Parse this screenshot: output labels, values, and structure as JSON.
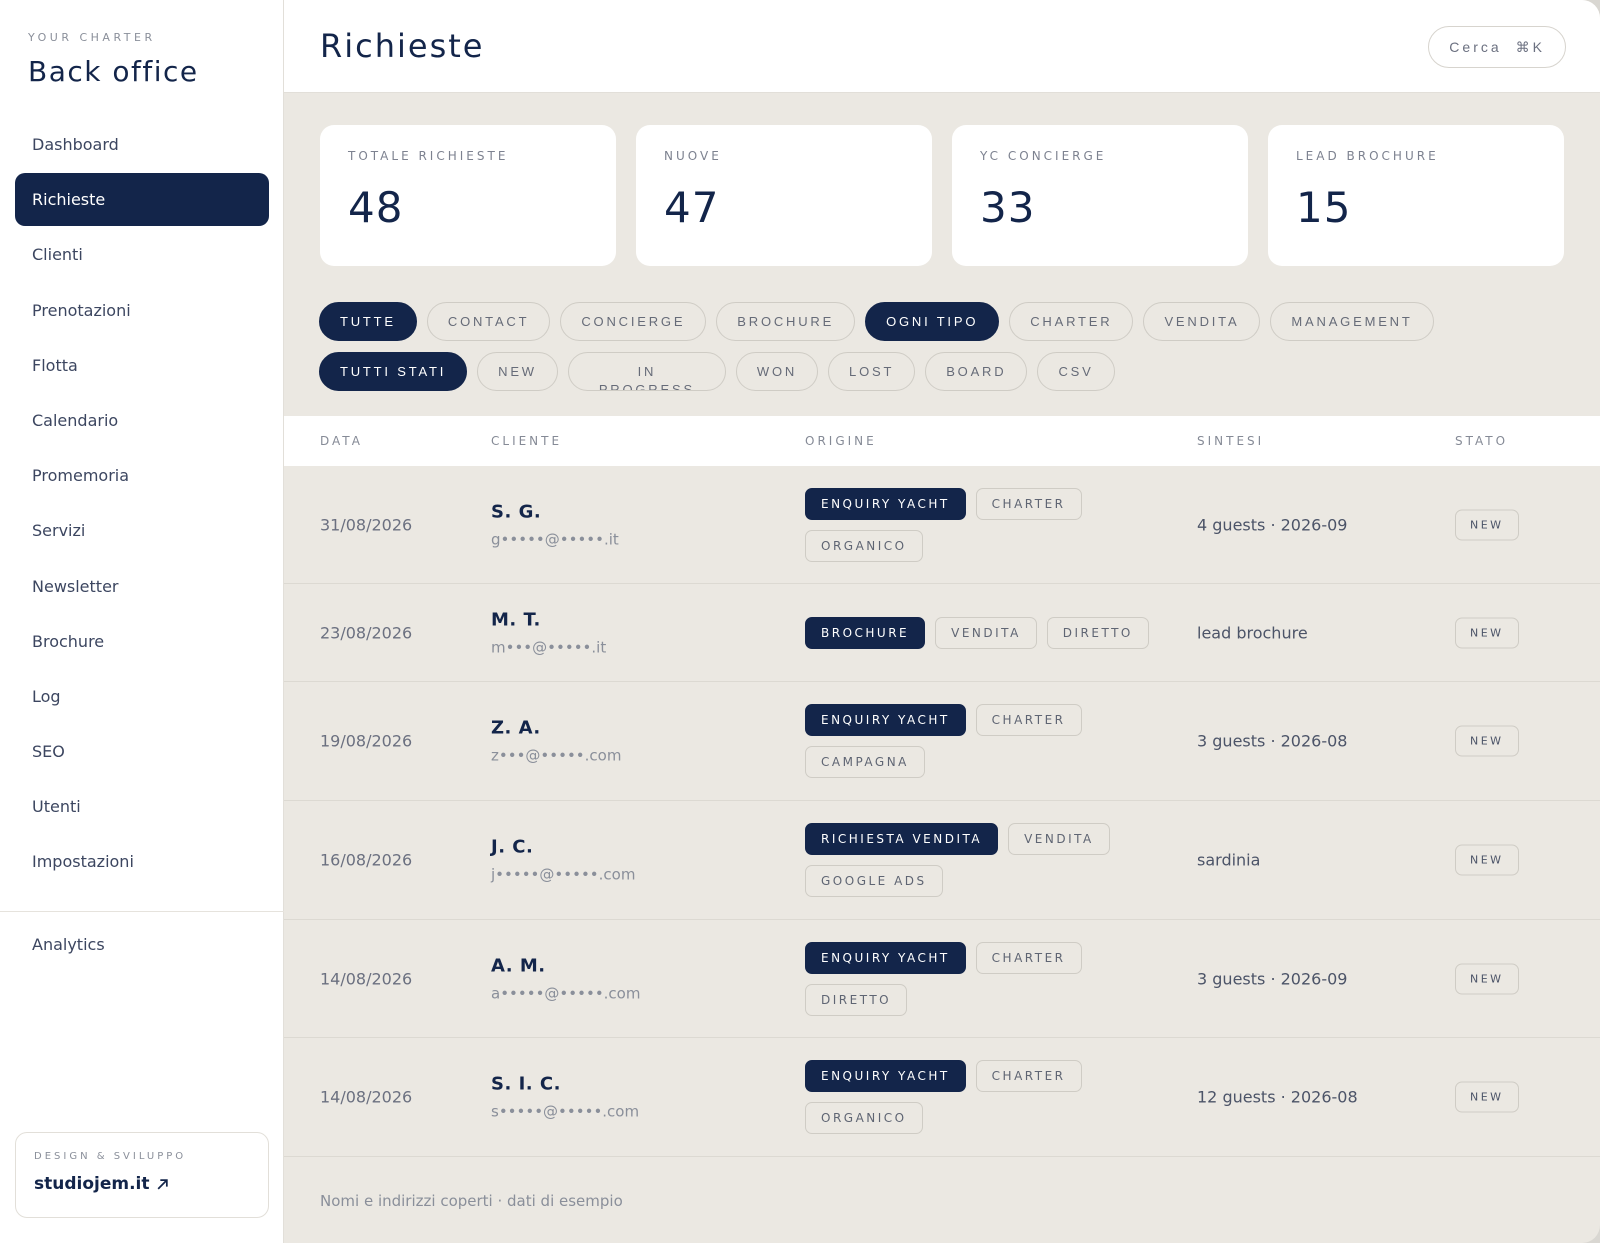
{
  "sidebar": {
    "kicker": "YOUR CHARTER",
    "title": "Back office",
    "items": [
      {
        "label": "Dashboard"
      },
      {
        "label": "Richieste"
      },
      {
        "label": "Clienti"
      },
      {
        "label": "Prenotazioni"
      },
      {
        "label": "Flotta"
      },
      {
        "label": "Calendario"
      },
      {
        "label": "Promemoria"
      },
      {
        "label": "Servizi"
      },
      {
        "label": "Newsletter"
      },
      {
        "label": "Brochure"
      },
      {
        "label": "Log"
      },
      {
        "label": "SEO"
      },
      {
        "label": "Utenti"
      },
      {
        "label": "Impostazioni"
      }
    ],
    "active_item": "Richieste",
    "extra_items": [
      {
        "label": "Analytics"
      }
    ],
    "credit": {
      "kicker": "DESIGN & SVILUPPO",
      "link": "studiojem.it"
    }
  },
  "header": {
    "title": "Richieste",
    "search_label": "Cerca",
    "search_shortcut": "⌘K"
  },
  "stats": [
    {
      "label": "TOTALE RICHIESTE",
      "value": "48"
    },
    {
      "label": "NUOVE",
      "value": "47"
    },
    {
      "label": "YC CONCIERGE",
      "value": "33"
    },
    {
      "label": "LEAD BROCHURE",
      "value": "15"
    }
  ],
  "filters": [
    {
      "label": "TUTTE",
      "active": true
    },
    {
      "label": "CONTACT",
      "active": false
    },
    {
      "label": "CONCIERGE",
      "active": false
    },
    {
      "label": "BROCHURE",
      "active": false
    },
    {
      "label": "OGNI TIPO",
      "active": true
    },
    {
      "label": "CHARTER",
      "active": false
    },
    {
      "label": "VENDITA",
      "active": false
    },
    {
      "label": "MANAGEMENT",
      "active": false
    },
    {
      "label": "TUTTI STATI",
      "active": true
    },
    {
      "label": "NEW",
      "active": false
    },
    {
      "label": "IN PROGRESS",
      "active": false
    },
    {
      "label": "WON",
      "active": false
    },
    {
      "label": "LOST",
      "active": false
    },
    {
      "label": "BOARD",
      "active": false
    },
    {
      "label": "CSV",
      "active": false
    }
  ],
  "table": {
    "columns": [
      "DATA",
      "CLIENTE",
      "ORIGINE",
      "SINTESI",
      "STATO"
    ],
    "rows": [
      {
        "date": "31/08/2026",
        "name": "S. G.",
        "email": "g•••••@•••••.it",
        "tags": [
          {
            "label": "ENQUIRY YACHT",
            "dark": true
          },
          {
            "label": "CHARTER",
            "dark": false
          },
          {
            "label": "ORGANICO",
            "dark": false
          }
        ],
        "summary": "4 guests · 2026-09",
        "status": "NEW"
      },
      {
        "date": "23/08/2026",
        "name": "M. T.",
        "email": "m•••@•••••.it",
        "tags": [
          {
            "label": "BROCHURE",
            "dark": true
          },
          {
            "label": "VENDITA",
            "dark": false
          },
          {
            "label": "DIRETTO",
            "dark": false
          }
        ],
        "summary": "lead brochure",
        "status": "NEW"
      },
      {
        "date": "19/08/2026",
        "name": "Z. A.",
        "email": "z•••@•••••.com",
        "tags": [
          {
            "label": "ENQUIRY YACHT",
            "dark": true
          },
          {
            "label": "CHARTER",
            "dark": false
          },
          {
            "label": "CAMPAGNA",
            "dark": false
          }
        ],
        "summary": "3 guests · 2026-08",
        "status": "NEW"
      },
      {
        "date": "16/08/2026",
        "name": "J. C.",
        "email": "j•••••@•••••.com",
        "tags": [
          {
            "label": "RICHIESTA VENDITA",
            "dark": true
          },
          {
            "label": "VENDITA",
            "dark": false
          },
          {
            "label": "GOOGLE ADS",
            "dark": false
          }
        ],
        "summary": "sardinia",
        "status": "NEW"
      },
      {
        "date": "14/08/2026",
        "name": "A. M.",
        "email": "a•••••@•••••.com",
        "tags": [
          {
            "label": "ENQUIRY YACHT",
            "dark": true
          },
          {
            "label": "CHARTER",
            "dark": false
          },
          {
            "label": "DIRETTO",
            "dark": false
          }
        ],
        "summary": "3 guests · 2026-09",
        "status": "NEW"
      },
      {
        "date": "14/08/2026",
        "name": "S. I. C.",
        "email": "s•••••@•••••.com",
        "tags": [
          {
            "label": "ENQUIRY YACHT",
            "dark": true
          },
          {
            "label": "CHARTER",
            "dark": false
          },
          {
            "label": "ORGANICO",
            "dark": false
          }
        ],
        "summary": "12 guests · 2026-08",
        "status": "NEW"
      }
    ]
  },
  "footnote": "Nomi e indirizzi coperti · dati di esempio",
  "colors": {
    "primary": "#13254a",
    "background": "#ebe8e2",
    "surface": "#ffffff"
  }
}
